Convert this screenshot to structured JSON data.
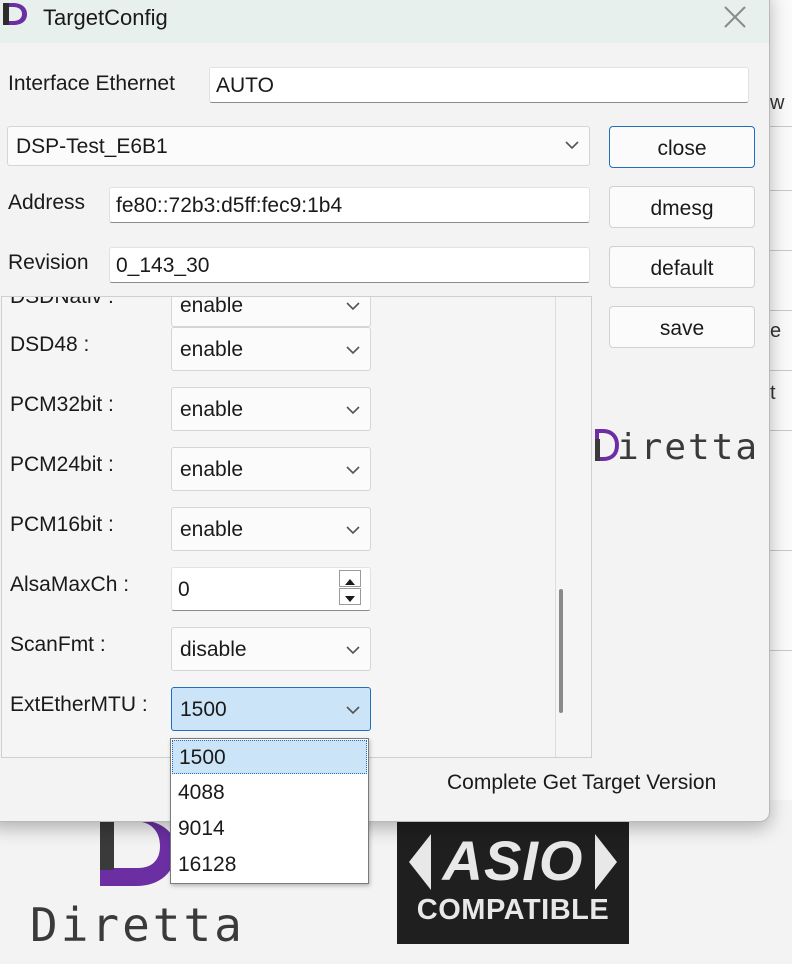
{
  "window": {
    "title": "TargetConfig"
  },
  "interface": {
    "label": "Interface Ethernet",
    "value": "AUTO"
  },
  "target": {
    "selected": "DSP-Test_E6B1"
  },
  "address": {
    "label": "Address",
    "value": "fe80::72b3:d5ff:fec9:1b4"
  },
  "revision": {
    "label": "Revision",
    "value": "0_143_30"
  },
  "buttons": {
    "close": "close",
    "dmesg": "dmesg",
    "default": "default",
    "save": "save"
  },
  "settings": [
    {
      "label": "DSDNativ :",
      "value": "enable"
    },
    {
      "label": "DSD48 :",
      "value": "enable"
    },
    {
      "label": "PCM32bit :",
      "value": "enable"
    },
    {
      "label": "PCM24bit :",
      "value": "enable"
    },
    {
      "label": "PCM16bit :",
      "value": "enable"
    },
    {
      "label": "AlsaMaxCh :",
      "value": "0"
    },
    {
      "label": "ScanFmt :",
      "value": "disable"
    },
    {
      "label": "ExtEtherMTU :",
      "value": "1500"
    }
  ],
  "mtu_dropdown": {
    "options": [
      "1500",
      "4088",
      "9014",
      "16128"
    ],
    "selected_index": 0
  },
  "status": "Complete Get Target Version",
  "brand": {
    "name": "Diretta"
  },
  "asio_badge": {
    "main": "ASIO",
    "sub": "COMPATIBLE"
  },
  "background": {
    "frag_1": "w",
    "frag_2": "e",
    "frag_3": "t"
  },
  "colors": {
    "accent": "#1f6fbf",
    "brand_purple": "#6b2fa3",
    "selection": "#cce4f7"
  }
}
